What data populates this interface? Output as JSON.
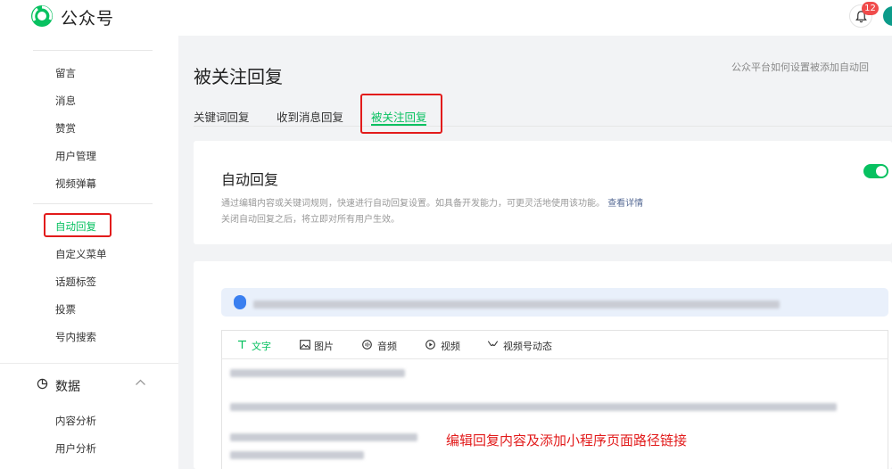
{
  "header": {
    "brand": "公众号",
    "notification_count": "12"
  },
  "sidebar": {
    "items": [
      {
        "label": "留言"
      },
      {
        "label": "消息"
      },
      {
        "label": "赞赏"
      },
      {
        "label": "用户管理"
      },
      {
        "label": "视频弹幕"
      },
      {
        "label": "自动回复",
        "active": true
      },
      {
        "label": "自定义菜单"
      },
      {
        "label": "话题标签"
      },
      {
        "label": "投票"
      },
      {
        "label": "号内搜索"
      }
    ],
    "section": "数据",
    "section_items": [
      {
        "label": "内容分析"
      },
      {
        "label": "用户分析"
      }
    ]
  },
  "main": {
    "title": "被关注回复",
    "help_link": "公众平台如何设置被添加自动回",
    "tabs": [
      {
        "label": "关键词回复"
      },
      {
        "label": "收到消息回复"
      },
      {
        "label": "被关注回复",
        "active": true
      }
    ],
    "auto_reply": {
      "title": "自动回复",
      "desc_line1": "通过编辑内容或关键词规则，快速进行自动回复设置。如具备开发能力，可更灵活地使用该功能。",
      "desc_more": "查看详情",
      "desc_line2": "关闭自动回复之后，将立即对所有用户生效。",
      "enabled": true
    },
    "editor": {
      "tools": [
        {
          "label": "文字",
          "icon": "text-icon",
          "active": true
        },
        {
          "label": "图片",
          "icon": "image-icon"
        },
        {
          "label": "音频",
          "icon": "audio-icon"
        },
        {
          "label": "视频",
          "icon": "video-icon"
        },
        {
          "label": "视频号动态",
          "icon": "channels-icon"
        }
      ],
      "annotation": "编辑回复内容及添加小程序页面路径链接"
    }
  },
  "colors": {
    "accent": "#07c160",
    "highlight": "#e21b1b",
    "link": "#576b95"
  }
}
